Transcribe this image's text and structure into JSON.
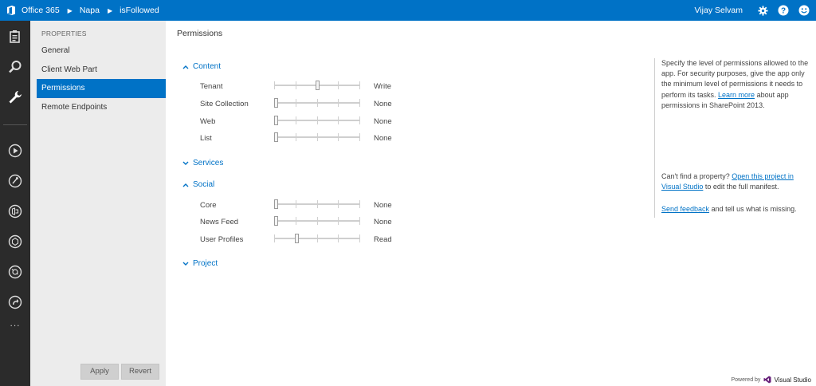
{
  "topbar": {
    "app_name": "Office 365",
    "crumbs": [
      "Napa",
      "isFollowed"
    ],
    "user_name": "Vijay Selvam",
    "icons": [
      "office-logo-icon",
      "gear-icon",
      "help-icon",
      "smiley-icon"
    ],
    "bg_color": "#0072c6"
  },
  "rail": {
    "icons": [
      "clipboard-icon",
      "search-icon",
      "wrench-icon",
      "run-icon",
      "publish-icon",
      "open-office-icon",
      "export-icon",
      "share-icon",
      "redo-icon"
    ],
    "more": "..."
  },
  "sidebar": {
    "heading": "PROPERTIES",
    "items": [
      {
        "label": "General",
        "active": false
      },
      {
        "label": "Client Web Part",
        "active": false
      },
      {
        "label": "Permissions",
        "active": true
      },
      {
        "label": "Remote Endpoints",
        "active": false
      }
    ],
    "apply_label": "Apply",
    "revert_label": "Revert"
  },
  "main": {
    "title": "Permissions",
    "sections": [
      {
        "label": "Content",
        "expanded": true,
        "rows": [
          {
            "label": "Tenant",
            "level": "Write",
            "position": 0.5
          },
          {
            "label": "Site Collection",
            "level": "None",
            "position": 0
          },
          {
            "label": "Web",
            "level": "None",
            "position": 0
          },
          {
            "label": "List",
            "level": "None",
            "position": 0
          }
        ]
      },
      {
        "label": "Services",
        "expanded": false,
        "rows": []
      },
      {
        "label": "Social",
        "expanded": true,
        "rows": [
          {
            "label": "Core",
            "level": "None",
            "position": 0
          },
          {
            "label": "News Feed",
            "level": "None",
            "position": 0
          },
          {
            "label": "User Profiles",
            "level": "Read",
            "position": 0.25
          }
        ]
      },
      {
        "label": "Project",
        "expanded": false,
        "rows": []
      }
    ]
  },
  "help": {
    "p1_text": "Specify the level of permissions allowed to the app. For security purposes, give the app only the minimum level of permissions it needs to perform its tasks.",
    "p1_link": "Learn more",
    "p1_tail": "about app permissions in SharePoint 2013.",
    "p2_text": "Can't find a property?",
    "p2_link": "Open this project in Visual Studio",
    "p2_tail": "to edit the full manifest.",
    "p3_link": "Send feedback",
    "p3_tail": "and tell us what is missing."
  },
  "footer": {
    "powered_by": "Powered by",
    "product": "Visual Studio"
  }
}
